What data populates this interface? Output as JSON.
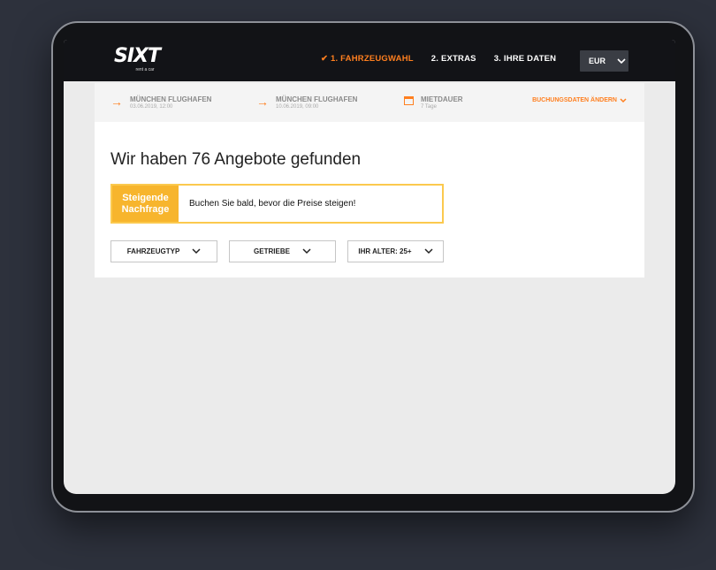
{
  "brand": {
    "logo_text": "SIXT",
    "tagline": "rent a car"
  },
  "steps": [
    {
      "label": "✔ 1. FAHRZEUGWAHL",
      "active": true
    },
    {
      "label": "2. EXTRAS",
      "active": false
    },
    {
      "label": "3. IHRE DATEN",
      "active": false
    }
  ],
  "currency": {
    "value": "EUR"
  },
  "booking": {
    "pickup": {
      "location": "MÜNCHEN FLUGHAFEN",
      "datetime": "03.06.2019, 12:00"
    },
    "return": {
      "location": "MÜNCHEN FLUGHAFEN",
      "datetime": "10.06.2019, 09:00"
    },
    "duration": {
      "label": "MIETDAUER",
      "value": "7 Tage"
    },
    "change_label": "BUCHUNGSDATEN ÄNDERN"
  },
  "results": {
    "heading": "Wir haben 76 Angebote gefunden"
  },
  "alert": {
    "tag_line1": "Steigende",
    "tag_line2": "Nachfrage",
    "message": "Buchen Sie bald, bevor die Preise steigen!"
  },
  "filters": [
    {
      "label": "FAHRZEUGTYP"
    },
    {
      "label": "GETRIEBE"
    },
    {
      "label": "IHR ALTER: 25+"
    }
  ],
  "colors": {
    "accent": "#ff7f1f",
    "alert": "#f7b52d",
    "header": "#121317"
  }
}
